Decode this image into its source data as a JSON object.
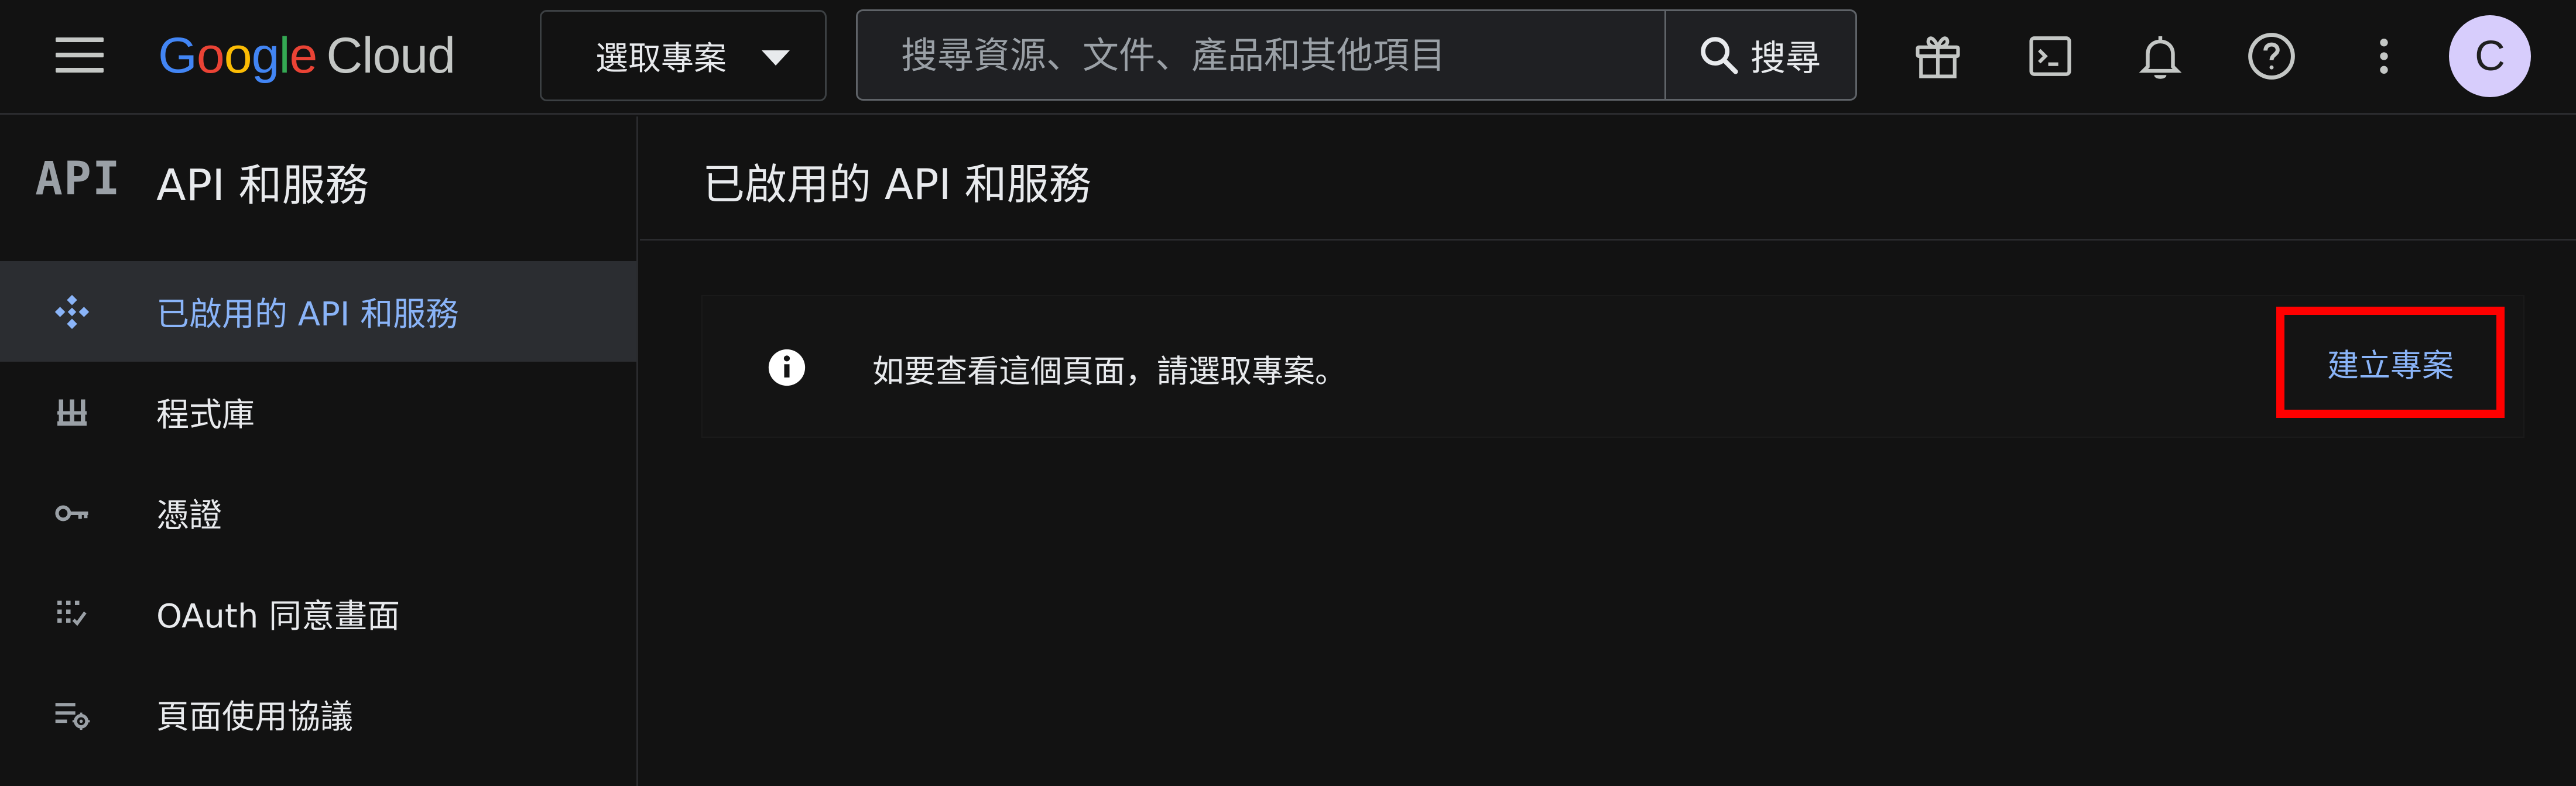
{
  "header": {
    "logo_google_letters": [
      "G",
      "o",
      "o",
      "g",
      "l",
      "e"
    ],
    "logo_google_colors": [
      "#4285f4",
      "#ea4335",
      "#fbbc04",
      "#4285f4",
      "#34a853",
      "#ea4335"
    ],
    "logo_product": "Cloud",
    "project_picker_label": "選取專案",
    "search_placeholder": "搜尋資源、文件、產品和其他項目",
    "search_button_label": "搜尋",
    "icons": [
      "gift-icon",
      "cloud-shell-icon",
      "notifications-icon",
      "help-icon",
      "more-vert-icon"
    ],
    "avatar_initial": "C",
    "avatar_color": "#d7cdfc"
  },
  "sidebar": {
    "logo_text": "API",
    "title": "API 和服務",
    "items": [
      {
        "label": "已啟用的 API 和服務",
        "icon": "api-diamond-icon",
        "active": true
      },
      {
        "label": "程式庫",
        "icon": "library-icon",
        "active": false
      },
      {
        "label": "憑證",
        "icon": "key-icon",
        "active": false
      },
      {
        "label": "OAuth 同意畫面",
        "icon": "oauth-consent-icon",
        "active": false
      },
      {
        "label": "頁面使用協議",
        "icon": "page-settings-icon",
        "active": false
      }
    ]
  },
  "main": {
    "title": "已啟用的 API 和服務",
    "banner": {
      "icon": "info-icon",
      "message": "如要查看這個頁面，請選取專案。",
      "action_label": "建立專案",
      "action_highlight_color": "#ff0000"
    }
  },
  "colors": {
    "background": "#121212",
    "accent_link": "#8ab4f8",
    "active_nav_bg": "#2b2d31"
  }
}
